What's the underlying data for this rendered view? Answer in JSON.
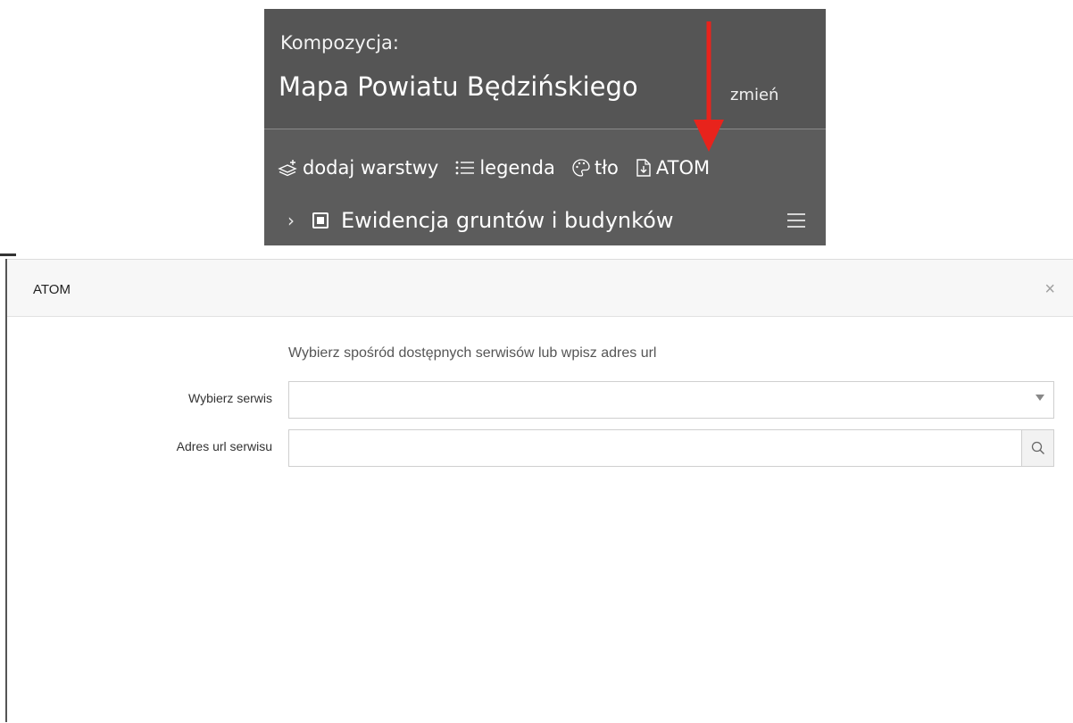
{
  "composition": {
    "label": "Kompozycja:",
    "name": "Mapa Powiatu Będzińskiego",
    "change_link": "zmień"
  },
  "toolbar": {
    "items": [
      {
        "label": "dodaj warstwy",
        "icon": "add-layers-icon"
      },
      {
        "label": "legenda",
        "icon": "list-icon"
      },
      {
        "label": "tło",
        "icon": "palette-icon"
      },
      {
        "label": "ATOM",
        "icon": "download-file-icon"
      }
    ]
  },
  "layer": {
    "name": "Ewidencja gruntów i budynków",
    "expand_icon": "chevron-right-icon",
    "menu_icon": "hamburger-menu-icon"
  },
  "annotation": {
    "arrow_color": "#e8231c"
  },
  "modal": {
    "title": "ATOM",
    "close_symbol": "×",
    "hint": "Wybierz spośród dostępnych serwisów lub wpisz adres url",
    "service_select": {
      "label": "Wybierz serwis",
      "value": ""
    },
    "url_field": {
      "label": "Adres url serwisu",
      "value": "",
      "placeholder": ""
    },
    "search_icon": "search-icon"
  },
  "colors": {
    "panel_bg": "#5c5c5c",
    "panel_top_bg": "#555555",
    "modal_header_bg": "#f7f7f7"
  }
}
